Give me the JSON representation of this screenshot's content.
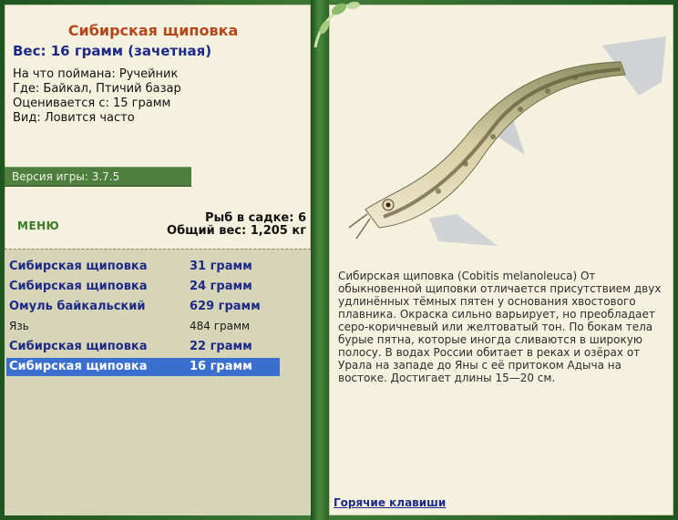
{
  "fish": {
    "title": "Сибирская щиповка",
    "weight_line": "Вес: 16 грамм (зачетная)",
    "caught_with": "На что поймана: Ручейник",
    "where": "Где: Байкал, Птичий базар",
    "price": "Оценивается с: 15 грамм",
    "kind": "Вид: Ловится часто"
  },
  "version": "Версия игры: 3.7.5",
  "menu_label": "МЕНЮ",
  "cage": {
    "count": "Рыб в садке: 6",
    "total_weight": "Общий вес: 1,205 кг"
  },
  "catch_list": [
    {
      "name": "Сибирская щиповка",
      "weight": "31 грамм",
      "style": "bold"
    },
    {
      "name": "Сибирская щиповка",
      "weight": "24 грамм",
      "style": "bold"
    },
    {
      "name": "Омуль байкальский",
      "weight": "629 грамм",
      "style": "bold"
    },
    {
      "name": "Язь",
      "weight": "484 грамм",
      "style": "plain"
    },
    {
      "name": "Сибирская щиповка",
      "weight": "22 грамм",
      "style": "bold"
    },
    {
      "name": "Сибирская щиповка",
      "weight": "16 грамм",
      "style": "selected"
    }
  ],
  "description": "Сибирская щиповка (Cobitis melanoleuca) От обыкновенной щиповки отличается присутствием двух удлинённых тёмных пятен у основания хвостового плавника. Окраска сильно варьирует, но преобладает серо-коричневый или желтоватый тон. По бокам тела бурые пятна, которые иногда сливаются в широкую полосу. В водах России обитает в реках и озёрах от Урала на западе до Яны с её притоком Адыча на востоке. Достигает длины 15—20 см.",
  "hotkeys_label": "Горячие клавиши",
  "colors": {
    "frame": "#2f6a2b",
    "panel": "#f4f1df",
    "title": "#b5471c",
    "accent_blue": "#1d2a88",
    "selected_row": "#3a6fcf",
    "version_bar": "#4f7f3f"
  }
}
